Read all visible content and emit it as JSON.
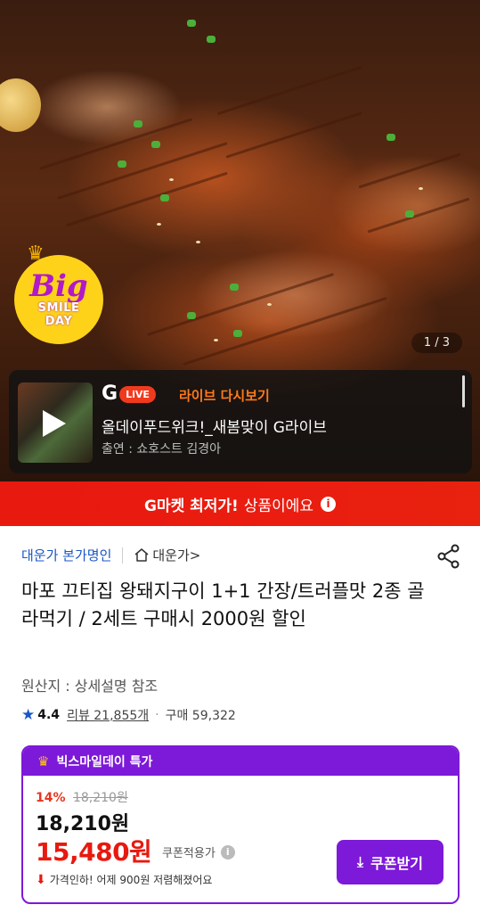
{
  "hero": {
    "badge_big": "Big",
    "badge_line1": "SMILE",
    "badge_line2": "DAY",
    "counter": "1 / 3"
  },
  "live": {
    "logo_g": "G",
    "logo_live": "LiVE",
    "replay": "라이브 다시보기",
    "title": "올데이푸드위크!_새봄맞이 G라이브",
    "host": "출연 : 쇼호스트 김경아"
  },
  "promo": {
    "bold": "G마켓 최저가!",
    "rest": "상품이에요"
  },
  "seller": {
    "name": "대운가 본가명인",
    "shop": "대운가",
    "shop_chevron": ">"
  },
  "product": {
    "title": "마포 끄티집 왕돼지구이 1+1 간장/트러플맛 2종 골라먹기 / 2세트 구매시 2000원 할인",
    "origin": "원산지 : 상세설명 참조",
    "rating": "4.4",
    "reviews": "리뷰 21,855개",
    "purchases": "구매 59,322"
  },
  "deal": {
    "header": "빅스마일데이 특가",
    "discount_pct": "14%",
    "original_price": "18,210원",
    "price": "18,210원",
    "coupon_price": "15,480원",
    "coupon_note": "쿠폰적용가",
    "drop_note": "가격인하! 어제 900원 저렴해졌어요",
    "coupon_button": "쿠폰받기"
  },
  "colors": {
    "accent": "#7d19d8",
    "promo_red": "#e8190f",
    "link_blue": "#1a56c4"
  }
}
